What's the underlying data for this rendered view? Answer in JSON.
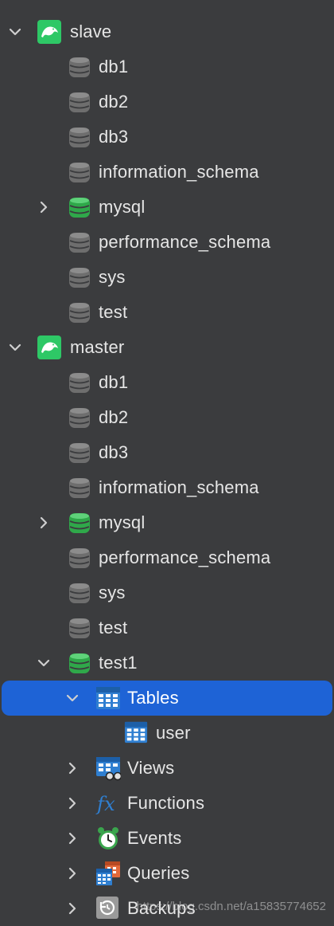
{
  "colors": {
    "background": "#3b3c3e",
    "selection": "#1e63d6",
    "db_inactive": "#6e6e6e",
    "db_active": "#2fa84a",
    "connection_icon": "#2ec866",
    "object_icon": "#2f7fd1"
  },
  "tree": [
    {
      "label": "slave",
      "level": 0,
      "icon": "mysql-connection-icon",
      "chevron": "down"
    },
    {
      "label": "db1",
      "level": 1,
      "icon": "database-icon",
      "active": false,
      "chevron": "none"
    },
    {
      "label": "db2",
      "level": 1,
      "icon": "database-icon",
      "active": false,
      "chevron": "none"
    },
    {
      "label": "db3",
      "level": 1,
      "icon": "database-icon",
      "active": false,
      "chevron": "none"
    },
    {
      "label": "information_schema",
      "level": 1,
      "icon": "database-icon",
      "active": false,
      "chevron": "none"
    },
    {
      "label": "mysql",
      "level": 1,
      "icon": "database-icon",
      "active": true,
      "chevron": "right"
    },
    {
      "label": "performance_schema",
      "level": 1,
      "icon": "database-icon",
      "active": false,
      "chevron": "none"
    },
    {
      "label": "sys",
      "level": 1,
      "icon": "database-icon",
      "active": false,
      "chevron": "none"
    },
    {
      "label": "test",
      "level": 1,
      "icon": "database-icon",
      "active": false,
      "chevron": "none"
    },
    {
      "label": "master",
      "level": 0,
      "icon": "mysql-connection-icon",
      "chevron": "down"
    },
    {
      "label": "db1",
      "level": 1,
      "icon": "database-icon",
      "active": false,
      "chevron": "none"
    },
    {
      "label": "db2",
      "level": 1,
      "icon": "database-icon",
      "active": false,
      "chevron": "none"
    },
    {
      "label": "db3",
      "level": 1,
      "icon": "database-icon",
      "active": false,
      "chevron": "none"
    },
    {
      "label": "information_schema",
      "level": 1,
      "icon": "database-icon",
      "active": false,
      "chevron": "none"
    },
    {
      "label": "mysql",
      "level": 1,
      "icon": "database-icon",
      "active": true,
      "chevron": "right"
    },
    {
      "label": "performance_schema",
      "level": 1,
      "icon": "database-icon",
      "active": false,
      "chevron": "none"
    },
    {
      "label": "sys",
      "level": 1,
      "icon": "database-icon",
      "active": false,
      "chevron": "none"
    },
    {
      "label": "test",
      "level": 1,
      "icon": "database-icon",
      "active": false,
      "chevron": "none"
    },
    {
      "label": "test1",
      "level": 1,
      "icon": "database-icon",
      "active": true,
      "chevron": "down"
    },
    {
      "label": "Tables",
      "level": 2,
      "icon": "tables-icon",
      "chevron": "down",
      "selected": true
    },
    {
      "label": "user",
      "level": 3,
      "icon": "table-icon",
      "chevron": "none"
    },
    {
      "label": "Views",
      "level": 2,
      "icon": "views-icon",
      "chevron": "right"
    },
    {
      "label": "Functions",
      "level": 2,
      "icon": "functions-icon",
      "chevron": "right"
    },
    {
      "label": "Events",
      "level": 2,
      "icon": "events-icon",
      "chevron": "right"
    },
    {
      "label": "Queries",
      "level": 2,
      "icon": "queries-icon",
      "chevron": "right"
    },
    {
      "label": "Backups",
      "level": 2,
      "icon": "backups-icon",
      "chevron": "right"
    }
  ],
  "watermark": "https://blog.csdn.net/a15835774652"
}
